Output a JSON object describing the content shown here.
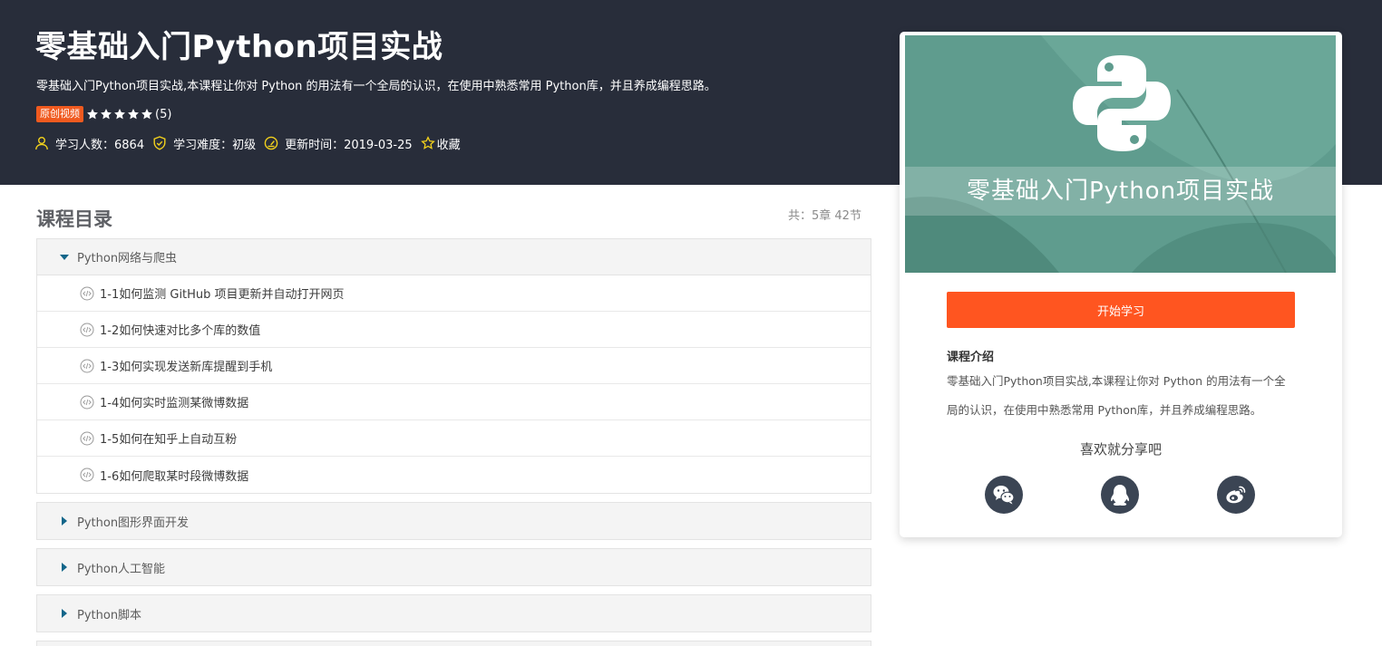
{
  "course": {
    "title": "零基础入门Python项目实战",
    "description": "零基础入门Python项目实战,本课程让你对 Python 的用法有一个全局的认识，在使用中熟悉常用 Python库，并且养成编程思路。",
    "badge": "原创视频",
    "rating": {
      "stars": 5,
      "max_stars": 5,
      "count_text": "(5)"
    },
    "meta": {
      "students": "学习人数：6864",
      "difficulty": "学习难度：初级",
      "updated": "更新时间：2019-03-25",
      "favorite": "收藏"
    }
  },
  "catalog": {
    "title": "课程目录",
    "count": "共：5章 42节",
    "chapters": [
      {
        "title": "Python网络与爬虫",
        "expanded": true,
        "lessons": [
          "1-1如何监测 GitHub 项目更新并自动打开网页",
          "1-2如何快速对比多个库的数值",
          "1-3如何实现发送新库提醒到手机",
          "1-4如何实时监测某微博数据",
          "1-5如何在知乎上自动互粉",
          "1-6如何爬取某时段微博数据"
        ]
      },
      {
        "title": "Python图形界面开发",
        "expanded": false
      },
      {
        "title": "Python人工智能",
        "expanded": false
      },
      {
        "title": "Python脚本",
        "expanded": false
      }
    ]
  },
  "card": {
    "banner_title": "零基础入门Python项目实战",
    "start_button": "开始学习",
    "intro_label": "课程介绍",
    "intro_text": "零基础入门Python项目实战,本课程让你对 Python 的用法有一个全局的认识，在使用中熟悉常用 Python库，并且养成编程思路。",
    "share_label": "喜欢就分享吧",
    "share_icons": [
      "wechat-icon",
      "qq-icon",
      "weibo-icon"
    ]
  },
  "colors": {
    "hero_bg": "#282d3a",
    "accent_orange": "#ff5520",
    "badge_orange": "#f05a1f",
    "meta_icon_yellow": "#f2d11c",
    "triangle_blue": "#13668a",
    "banner_green": "#5f9c8e",
    "share_icon_bg": "#3b4554"
  }
}
